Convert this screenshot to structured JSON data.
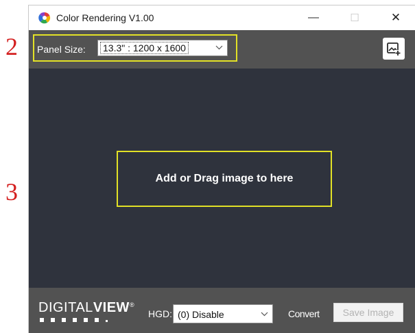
{
  "annotations": {
    "step_2": "2",
    "step_3": "3"
  },
  "window": {
    "title": "Color Rendering V1.00",
    "app_icon": "color-wheel-icon",
    "controls": {
      "minimize": "—",
      "maximize": "☐",
      "close": "✕"
    }
  },
  "toolbar": {
    "panel_size_label": "Panel Size:",
    "panel_size_value": "13.3\" : 1200 x 1600",
    "add_image_icon": "add-image-icon"
  },
  "drop_zone": {
    "text": "Add or Drag image to here"
  },
  "bottom": {
    "logo_text_light": "DIGITAL",
    "logo_text_bold": "VIEW",
    "logo_reg": "®",
    "hgd_label": "HGD:",
    "hgd_value": "(0) Disable",
    "convert_label": "Convert",
    "save_label": "Save Image"
  },
  "colors": {
    "canvas": "#2f333d",
    "bar": "#525252",
    "highlight": "#e3e226",
    "annotation": "#d42020"
  }
}
